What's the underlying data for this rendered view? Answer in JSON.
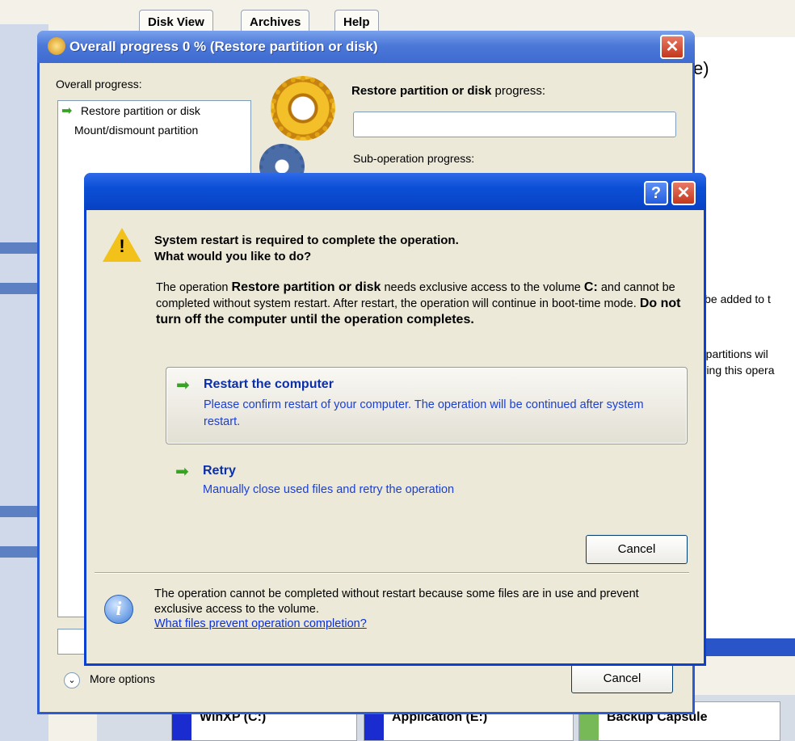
{
  "background_app": {
    "tabs": [
      "Disk View",
      "Archives",
      "Help"
    ],
    "header_fragment": "e)",
    "text_fragments": [
      "ll be added to t",
      "e partitions wil",
      "uring this opera"
    ],
    "disks": [
      {
        "label": "WinXP (C:)",
        "color": "#1a2bd0"
      },
      {
        "label": "Application (E:)",
        "color": "#1a2bd0"
      },
      {
        "label": "Backup Capsule",
        "color": "#77b857"
      }
    ]
  },
  "progress_window": {
    "title": "Overall progress 0 % (Restore partition or disk)",
    "close_glyph": "✕",
    "overall_label": "Overall progress:",
    "operations": [
      "Restore partition or disk",
      "Mount/dismount partition"
    ],
    "restore_progress_bold": "Restore partition or disk",
    "restore_progress_suffix": " progress:",
    "sub_operation_label": "Sub-operation progress:",
    "more_options_label": "More options",
    "cancel_label": "Cancel"
  },
  "restart_dialog": {
    "help_glyph": "?",
    "close_glyph": "✕",
    "heading_line1": "System restart is required to complete the operation.",
    "heading_line2": "What would you like to do?",
    "body_part1": "The operation ",
    "body_op_name": "Restore partition or disk",
    "body_part2": " needs exclusive access to the volume ",
    "body_volume": "C:",
    "body_part3": " and cannot be completed without system restart. After restart, the operation will continue in boot-time mode. ",
    "body_warning": "Do not turn off the computer until the operation completes.",
    "options": [
      {
        "title": "Restart the computer",
        "description": "Please confirm restart of your computer. The operation will be continued after system restart."
      },
      {
        "title": "Retry",
        "description": "Manually close used files and retry the operation"
      }
    ],
    "cancel_label": "Cancel",
    "footer_text": "The operation cannot be completed without restart because some files are in use and prevent exclusive access to the volume.",
    "footer_link": "What files prevent operation completion?"
  }
}
